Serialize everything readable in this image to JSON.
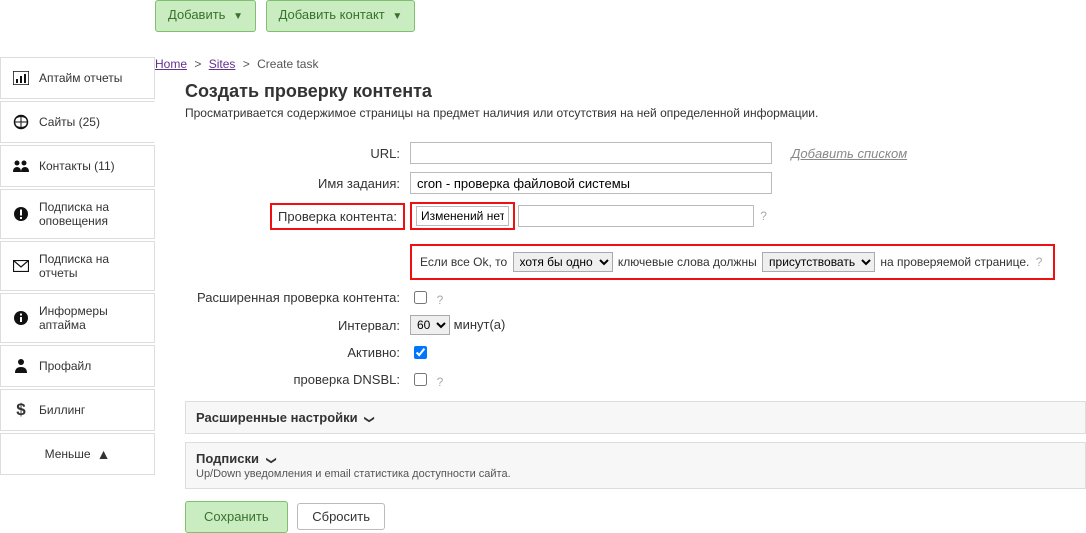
{
  "top_buttons": {
    "add": "Добавить",
    "add_contact": "Добавить контакт"
  },
  "sidebar": {
    "items": [
      {
        "label": "Аптайм отчеты"
      },
      {
        "label": "Сайты (25)"
      },
      {
        "label": "Контакты (11)"
      },
      {
        "label": "Подписка на оповещения"
      },
      {
        "label": "Подписка на отчеты"
      },
      {
        "label": "Информеры аптайма"
      },
      {
        "label": "Профайл"
      },
      {
        "label": "Биллинг"
      }
    ],
    "less": "Меньше"
  },
  "breadcrumbs": {
    "home": "Home",
    "sites": "Sites",
    "current": "Create task"
  },
  "page": {
    "title": "Создать проверку контента",
    "subtitle": "Просматривается содержимое страницы на предмет наличия или отсутствия на ней определенной информации."
  },
  "form": {
    "url_label": "URL:",
    "url_value": "",
    "add_list_link": "Добавить списком",
    "task_name_label": "Имя задания:",
    "task_name_value": "cron - проверка файловой системы",
    "content_check_label": "Проверка контента:",
    "content_check_value": "Изменений нет",
    "rule_prefix": "Если все Ok, то",
    "rule_mid": "ключевые слова должны",
    "rule_suffix": "на проверяемой странице.",
    "qty_select": "хотя бы одно",
    "presence_select": "присутствовать",
    "ext_check_label": "Расширенная проверка контента:",
    "interval_label": "Интервал:",
    "interval_value": "60",
    "interval_unit": "минут(а)",
    "active_label": "Активно:",
    "dnsbl_label": "проверка DNSBL:"
  },
  "sections": {
    "advanced": "Расширенные настройки",
    "subscriptions": "Подписки",
    "subscriptions_sub": "Up/Down уведомления и email статистика доступности сайта."
  },
  "bottom": {
    "save": "Сохранить",
    "reset": "Сбросить"
  }
}
